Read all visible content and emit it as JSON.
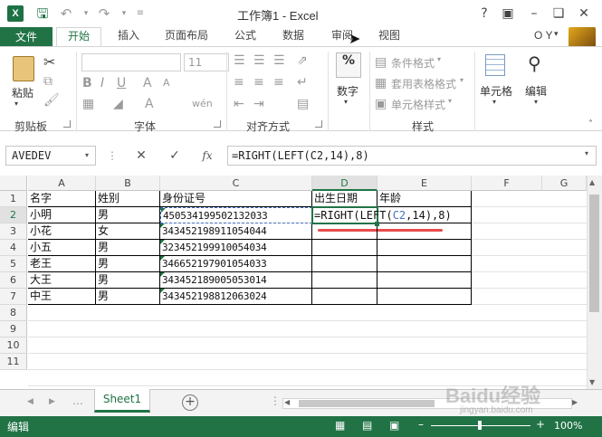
{
  "app": {
    "title": "工作簿1 - Excel",
    "help": "?",
    "user": "O Y"
  },
  "tabs": [
    "文件",
    "开始",
    "插入",
    "页面布局",
    "公式",
    "数据",
    "审阅",
    "视图"
  ],
  "ribbon": {
    "clipboard": {
      "paste": "粘贴",
      "group": "剪贴板"
    },
    "font": {
      "size": "11",
      "group": "字体"
    },
    "alignment": {
      "group": "对齐方式"
    },
    "number": {
      "label": "数字",
      "icon_text": "%"
    },
    "styles": {
      "conditional": "条件格式",
      "table": "套用表格格式",
      "cell": "单元格样式",
      "group": "样式"
    },
    "cells": {
      "label": "单元格"
    },
    "editing": {
      "label": "编辑"
    }
  },
  "formula_bar": {
    "name_box": "AVEDEV",
    "formula": "=RIGHT(LEFT(C2,14),8)",
    "fx": "fx"
  },
  "columns": [
    "A",
    "B",
    "C",
    "D",
    "E",
    "F",
    "G"
  ],
  "rows": [
    "1",
    "2",
    "3",
    "4",
    "5",
    "6",
    "7",
    "8",
    "9",
    "10",
    "11"
  ],
  "table": {
    "headers": [
      "名字",
      "姓别",
      "身份证号",
      "出生日期",
      "年龄"
    ],
    "data": [
      {
        "name": "小明",
        "gender": "男",
        "id": "450534199502132033"
      },
      {
        "name": "小花",
        "gender": "女",
        "id": "343452198911054044"
      },
      {
        "name": "小五",
        "gender": "男",
        "id": "323452199910054034"
      },
      {
        "name": "老王",
        "gender": "男",
        "id": "346652197901054033"
      },
      {
        "name": "大王",
        "gender": "男",
        "id": "343452189005053014"
      },
      {
        "name": "中王",
        "gender": "男",
        "id": "343452198812063024"
      }
    ],
    "active_formula": {
      "part1": "=RIGHT(LEFT(",
      "ref": "C2",
      "part2": ",14),8)"
    }
  },
  "sheet": {
    "tab": "Sheet1"
  },
  "status": {
    "mode": "编辑",
    "zoom": "100%"
  },
  "watermark": {
    "brand": "Baidu经验",
    "url": "jingyan.baidu.com"
  },
  "colors": {
    "accent": "#217346",
    "ref_highlight": "#4472c4",
    "annotation": "#e84c4c"
  }
}
